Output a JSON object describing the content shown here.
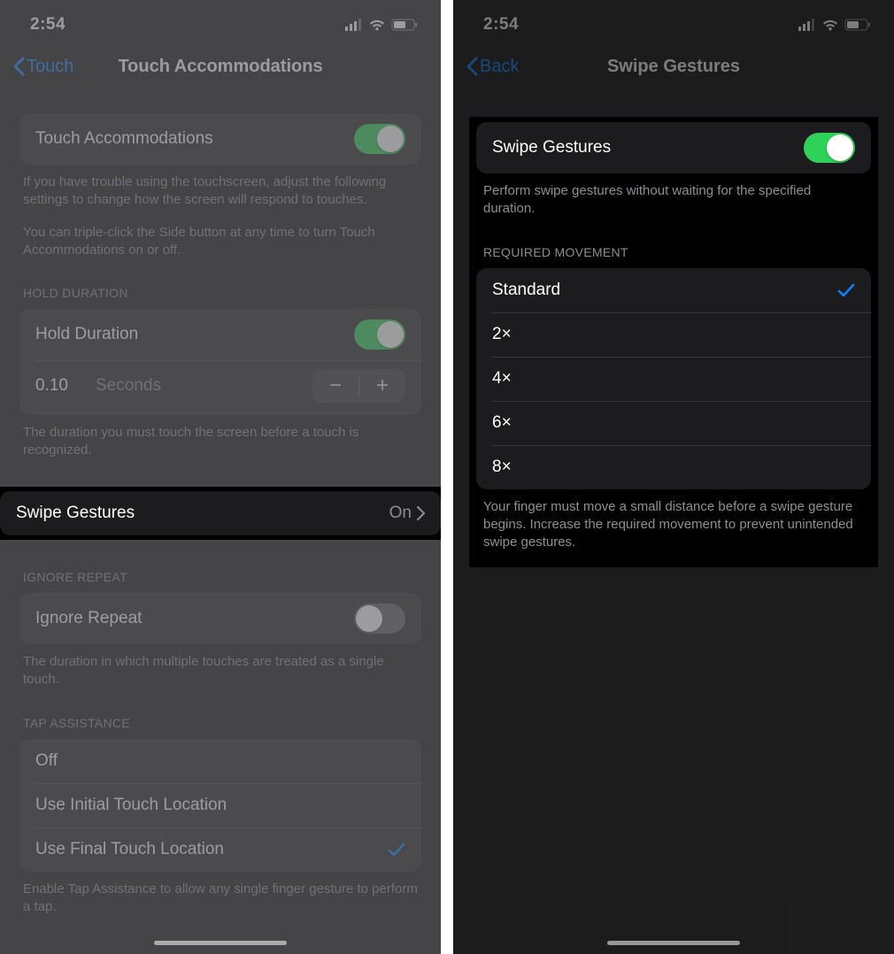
{
  "left": {
    "status": {
      "time": "2:54"
    },
    "nav": {
      "back": "Touch",
      "title": "Touch Accommodations"
    },
    "touchAccom": {
      "label": "Touch Accommodations",
      "footer1": "If you have trouble using the touchscreen, adjust the following settings to change how the screen will respond to touches.",
      "footer2": "You can triple-click the Side button at any time to turn Touch Accommodations on or off."
    },
    "holdDuration": {
      "header": "HOLD DURATION",
      "label": "Hold Duration",
      "value": "0.10",
      "unit": "Seconds",
      "footer": "The duration you must touch the screen before a touch is recognized."
    },
    "swipeGestures": {
      "label": "Swipe Gestures",
      "value": "On"
    },
    "ignoreRepeat": {
      "header": "IGNORE REPEAT",
      "label": "Ignore Repeat",
      "footer": "The duration in which multiple touches are treated as a single touch."
    },
    "tapAssist": {
      "header": "TAP ASSISTANCE",
      "options": [
        "Off",
        "Use Initial Touch Location",
        "Use Final Touch Location"
      ],
      "selectedIndex": 2,
      "footer": "Enable Tap Assistance to allow any single finger gesture to perform a tap."
    }
  },
  "right": {
    "status": {
      "time": "2:54"
    },
    "nav": {
      "back": "Back",
      "title": "Swipe Gestures"
    },
    "swipeGestures": {
      "label": "Swipe Gestures",
      "footer": "Perform swipe gestures without waiting for the specified duration."
    },
    "requiredMovement": {
      "header": "REQUIRED MOVEMENT",
      "options": [
        "Standard",
        "2×",
        "4×",
        "6×",
        "8×"
      ],
      "selectedIndex": 0,
      "footer": "Your finger must move a small distance before a swipe gesture begins. Increase the required movement to prevent unintended swipe gestures."
    }
  }
}
